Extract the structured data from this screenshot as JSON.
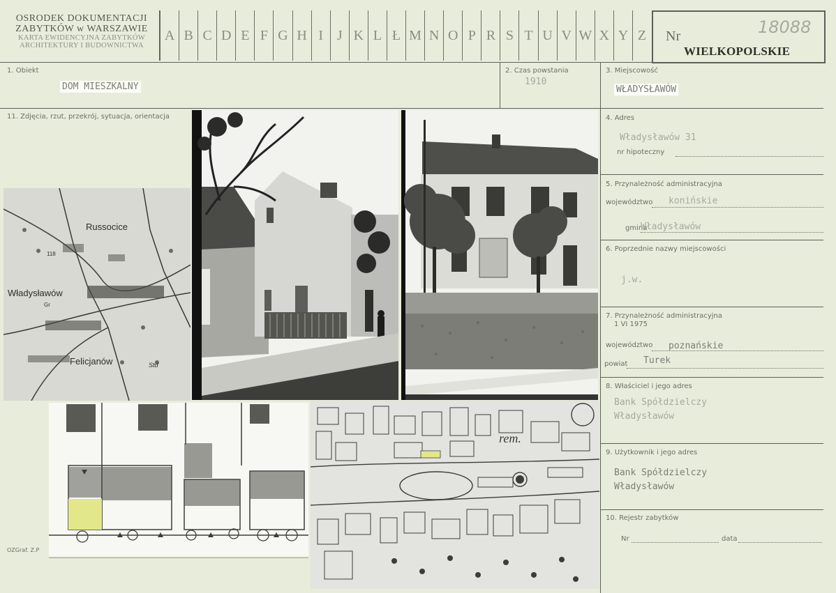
{
  "header": {
    "org_line1": "OSRODEK DOKUMENTACJI",
    "org_line2": "ZABYTKÓW w WARSZAWIE",
    "org_line3": "KARTA EWIDENCYJNA ZABYTKÓW",
    "org_line4": "ARCHITEKTURY I BUDOWNICTWA",
    "letters": [
      "A",
      "B",
      "C",
      "D",
      "E",
      "F",
      "G",
      "H",
      "I",
      "J",
      "K",
      "L",
      "Ł",
      "M",
      "N",
      "O",
      "P",
      "R",
      "S",
      "T",
      "U",
      "V",
      "W",
      "X",
      "Y",
      "Z"
    ],
    "nr_label": "Nr",
    "nr_value": "18088",
    "region": "WIELKOPOLSKIE"
  },
  "fields": {
    "obiekt_label": "1. Obiekt",
    "obiekt_value": "DOM MIESZKALNY",
    "czas_label": "2. Czas powstania",
    "czas_value": "1910",
    "miejscowosc_label": "3. Miejscowość",
    "miejscowosc_value": "WŁADYSŁAWÓW",
    "zdjecia_label": "11. Zdjęcia, rzut, przekrój, sytuacja, orientacja",
    "adres_label": "4. Adres",
    "adres_value": "Władysławów 31",
    "nr_hip_label": "nr hipoteczny",
    "przyn_label": "5. Przynależność administracyjna",
    "wojewodztwo_label": "województwo",
    "wojewodztwo_value": "konińskie",
    "gmina_label": "gmina",
    "gmina_value": "Władysławów",
    "poprzednie_label": "6. Poprzednie nazwy miejscowości",
    "poprzednie_value": "j.w.",
    "przyn2_label": "7. Przynależność administracyjna",
    "przyn2_date": "1 VI 1975",
    "wojewodztwo2_label": "województwo",
    "wojewodztwo2_value": "poznańskie",
    "powiat_label": "powiat",
    "powiat_value": "Turek",
    "wlasciciel_label": "8. Właściciel i jego adres",
    "wlasciciel_line1": "Bank Spółdzielczy",
    "wlasciciel_line2": "Władysławów",
    "uzytkownik_label": "9. Użytkownik i jego adres",
    "uzytkownik_line1": "Bank Spółdzielczy",
    "uzytkownik_line2": "Władysławów",
    "rejestr_label": "10. Rejestr zabytków",
    "rejestr_nr_label": "Nr",
    "rejestr_data_label": "data",
    "footer_code": "OZGraf. Z.P"
  },
  "map1": {
    "town1": "Russocice",
    "town2": "Władysławów",
    "town3": "Felicjanów",
    "marker1": "118",
    "marker2": "Gr",
    "marker3": "Std"
  },
  "map2": {
    "label": "rem."
  },
  "colors": {
    "card": "#e8eddb",
    "ink": "#4a4d44",
    "highlight": "#e2e88a"
  }
}
